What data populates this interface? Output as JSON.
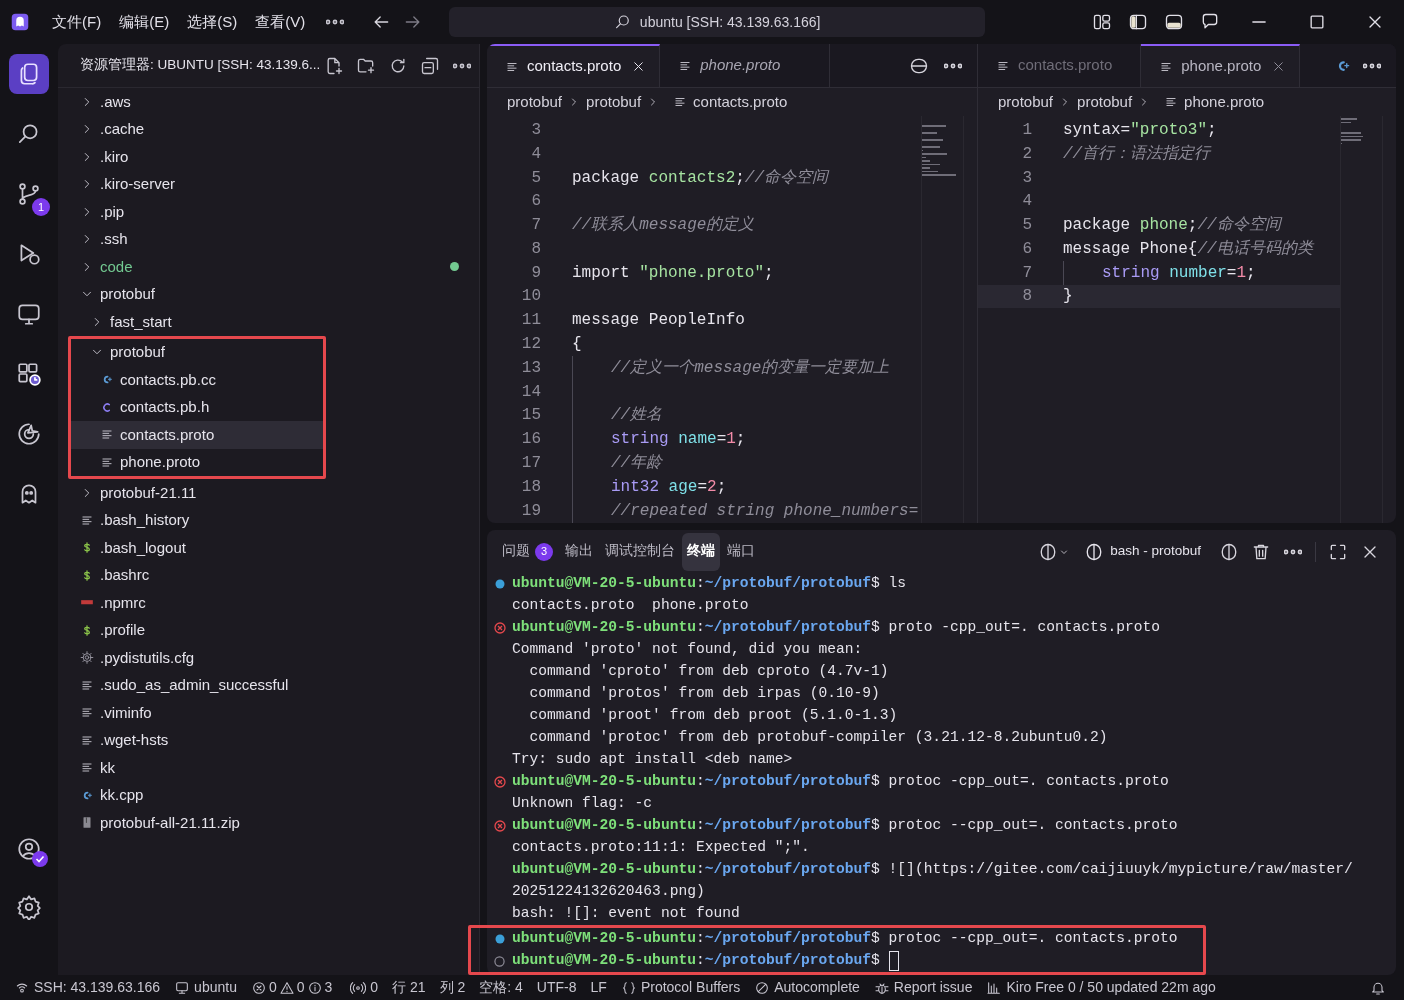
{
  "title_bar": {
    "menus": [
      "文件(F)",
      "编辑(E)",
      "选择(S)",
      "查看(V)"
    ],
    "search": "ubuntu [SSH: 43.139.63.166]"
  },
  "activity_bar": {
    "items": [
      {
        "kind": "explorer",
        "selected": true
      },
      {
        "kind": "search",
        "selected": false
      },
      {
        "kind": "source-control",
        "selected": false,
        "badge": "1"
      },
      {
        "kind": "debug",
        "selected": false
      },
      {
        "kind": "remote",
        "selected": false
      },
      {
        "kind": "extensions",
        "selected": false
      },
      {
        "kind": "kiro",
        "selected": false
      },
      {
        "kind": "chat",
        "selected": false
      }
    ],
    "bottom": [
      {
        "kind": "account"
      },
      {
        "kind": "settings"
      }
    ]
  },
  "explorer": {
    "title": "资源管理器: UBUNTU [SSH: 43.139.6...",
    "tree": [
      {
        "label": ".aws",
        "kind": "folder",
        "expanded": false,
        "selected": false,
        "untracked": false
      },
      {
        "label": ".cache",
        "kind": "folder",
        "expanded": false,
        "selected": false,
        "untracked": false
      },
      {
        "label": ".kiro",
        "kind": "folder",
        "expanded": false,
        "selected": false,
        "untracked": false
      },
      {
        "label": ".kiro-server",
        "kind": "folder",
        "expanded": false,
        "selected": false,
        "untracked": false
      },
      {
        "label": ".pip",
        "kind": "folder",
        "expanded": false,
        "selected": false,
        "untracked": false
      },
      {
        "label": ".ssh",
        "kind": "folder",
        "expanded": false,
        "selected": false,
        "untracked": false
      },
      {
        "label": "code",
        "kind": "folder",
        "expanded": false,
        "selected": false,
        "untracked": true
      },
      {
        "label": "protobuf",
        "kind": "folder",
        "expanded": true,
        "selected": false,
        "untracked": false,
        "children": [
          {
            "label": "fast_start",
            "kind": "folder",
            "expanded": false,
            "selected": false,
            "untracked": false
          },
          {
            "label": "protobuf",
            "kind": "folder",
            "expanded": true,
            "selected": false,
            "untracked": false,
            "highlighted": true,
            "children": [
              {
                "label": "contacts.pb.cc",
                "kind": "cpp",
                "selected": false,
                "untracked": false
              },
              {
                "label": "contacts.pb.h",
                "kind": "c",
                "selected": false,
                "untracked": false
              },
              {
                "label": "contacts.proto",
                "kind": "text",
                "selected": true,
                "untracked": false
              },
              {
                "label": "phone.proto",
                "kind": "text",
                "selected": false,
                "untracked": false
              }
            ]
          }
        ]
      },
      {
        "label": "protobuf-21.11",
        "kind": "folder",
        "expanded": false,
        "selected": false,
        "untracked": false
      },
      {
        "label": ".bash_history",
        "kind": "text",
        "selected": false,
        "untracked": false
      },
      {
        "label": ".bash_logout",
        "kind": "shell",
        "selected": false,
        "untracked": false
      },
      {
        "label": ".bashrc",
        "kind": "shell",
        "selected": false,
        "untracked": false
      },
      {
        "label": ".npmrc",
        "kind": "npm",
        "selected": false,
        "untracked": false
      },
      {
        "label": ".profile",
        "kind": "shell",
        "selected": false,
        "untracked": false
      },
      {
        "label": ".pydistutils.cfg",
        "kind": "config",
        "selected": false,
        "untracked": false
      },
      {
        "label": ".sudo_as_admin_successful",
        "kind": "text",
        "selected": false,
        "untracked": false
      },
      {
        "label": ".viminfo",
        "kind": "text",
        "selected": false,
        "untracked": false
      },
      {
        "label": ".wget-hsts",
        "kind": "text",
        "selected": false,
        "untracked": false
      },
      {
        "label": "kk",
        "kind": "text",
        "selected": false,
        "untracked": false
      },
      {
        "label": "kk.cpp",
        "kind": "cpp",
        "selected": false,
        "untracked": false
      },
      {
        "label": "protobuf-all-21.11.zip",
        "kind": "archive",
        "selected": false,
        "untracked": false
      }
    ]
  },
  "editor_groups": [
    {
      "tabs": [
        {
          "label": "contacts.proto",
          "selected": true,
          "preview": false
        },
        {
          "label": "phone.proto",
          "selected": false,
          "preview": true
        }
      ],
      "breadcrumbs": [
        "protobuf",
        "protobuf",
        "contacts.proto"
      ],
      "lines": [
        {
          "number": "3",
          "current": false,
          "indented": false
        },
        {
          "number": "4",
          "current": false,
          "indented": false
        },
        {
          "number": "5",
          "current": false,
          "indented": false,
          "tokens": [
            {
              "text": "package ",
              "kind": "plain"
            },
            {
              "text": "contacts2",
              "kind": "string"
            },
            {
              "text": ";",
              "kind": "plain"
            },
            {
              "text": "//命令空间",
              "kind": "comment"
            }
          ]
        },
        {
          "number": "6",
          "current": false,
          "indented": false
        },
        {
          "number": "7",
          "current": false,
          "indented": false,
          "tokens": [
            {
              "text": "//联系人message的定义",
              "kind": "comment"
            }
          ]
        },
        {
          "number": "8",
          "current": false,
          "indented": false
        },
        {
          "number": "9",
          "current": false,
          "indented": false,
          "tokens": [
            {
              "text": "import ",
              "kind": "plain"
            },
            {
              "text": "\"phone.proto\"",
              "kind": "string"
            },
            {
              "text": ";",
              "kind": "plain"
            }
          ]
        },
        {
          "number": "10",
          "current": false,
          "indented": false
        },
        {
          "number": "11",
          "current": false,
          "indented": false,
          "tokens": [
            {
              "text": "message PeopleInfo",
              "kind": "plain"
            }
          ]
        },
        {
          "number": "12",
          "current": false,
          "indented": false,
          "tokens": [
            {
              "text": "{",
              "kind": "plain"
            }
          ]
        },
        {
          "number": "13",
          "current": false,
          "indented": true,
          "tokens": [
            {
              "text": "//定义一个message的变量一定要加上",
              "kind": "comment"
            }
          ]
        },
        {
          "number": "14",
          "current": false,
          "indented": true
        },
        {
          "number": "15",
          "current": false,
          "indented": true,
          "tokens": [
            {
              "text": "//姓名",
              "kind": "comment"
            }
          ]
        },
        {
          "number": "16",
          "current": false,
          "indented": true,
          "tokens": [
            {
              "text": "string ",
              "kind": "type"
            },
            {
              "text": "name",
              "kind": "name"
            },
            {
              "text": "=",
              "kind": "plain"
            },
            {
              "text": "1",
              "kind": "number"
            },
            {
              "text": ";",
              "kind": "plain"
            }
          ]
        },
        {
          "number": "17",
          "current": false,
          "indented": true,
          "tokens": [
            {
              "text": "//年龄",
              "kind": "comment"
            }
          ]
        },
        {
          "number": "18",
          "current": false,
          "indented": true,
          "tokens": [
            {
              "text": "int32 ",
              "kind": "type"
            },
            {
              "text": "age",
              "kind": "name"
            },
            {
              "text": "=",
              "kind": "plain"
            },
            {
              "text": "2",
              "kind": "number"
            },
            {
              "text": ";",
              "kind": "plain"
            }
          ]
        },
        {
          "number": "19",
          "current": false,
          "indented": true,
          "tokens": [
            {
              "text": "//repeated string phone_numbers=",
              "kind": "comment"
            }
          ]
        }
      ]
    },
    {
      "tabs": [
        {
          "label": "contacts.proto",
          "selected": false,
          "preview": false
        },
        {
          "label": "phone.proto",
          "selected": true,
          "preview": false
        }
      ],
      "breadcrumbs": [
        "protobuf",
        "protobuf",
        "phone.proto"
      ],
      "lines": [
        {
          "number": "1",
          "current": false,
          "indented": false,
          "tokens": [
            {
              "text": "syntax=",
              "kind": "plain"
            },
            {
              "text": "\"proto3\"",
              "kind": "string"
            },
            {
              "text": ";",
              "kind": "plain"
            }
          ]
        },
        {
          "number": "2",
          "current": false,
          "indented": false,
          "tokens": [
            {
              "text": "//首行：语法指定行",
              "kind": "comment"
            }
          ]
        },
        {
          "number": "3",
          "current": false,
          "indented": false
        },
        {
          "number": "4",
          "current": false,
          "indented": false
        },
        {
          "number": "5",
          "current": false,
          "indented": false,
          "tokens": [
            {
              "text": "package ",
              "kind": "plain"
            },
            {
              "text": "phone",
              "kind": "string"
            },
            {
              "text": ";",
              "kind": "plain"
            },
            {
              "text": "//命令空间",
              "kind": "comment"
            }
          ]
        },
        {
          "number": "6",
          "current": false,
          "indented": false,
          "tokens": [
            {
              "text": "message Phone{",
              "kind": "plain"
            },
            {
              "text": "//电话号码的类",
              "kind": "comment"
            }
          ]
        },
        {
          "number": "7",
          "current": false,
          "indented": true,
          "tokens": [
            {
              "text": "string ",
              "kind": "type"
            },
            {
              "text": "number",
              "kind": "name"
            },
            {
              "text": "=",
              "kind": "plain"
            },
            {
              "text": "1",
              "kind": "number"
            },
            {
              "text": ";",
              "kind": "plain"
            }
          ]
        },
        {
          "number": "8",
          "current": true,
          "indented": false,
          "tokens": [
            {
              "text": "}",
              "kind": "plain"
            }
          ]
        }
      ]
    }
  ],
  "panel": {
    "tabs": [
      {
        "label": "问题",
        "badge": "3",
        "selected": false
      },
      {
        "label": "输出",
        "selected": false
      },
      {
        "label": "调试控制台",
        "selected": false
      },
      {
        "label": "终端",
        "selected": true
      },
      {
        "label": "端口",
        "selected": false
      }
    ],
    "terminal_name": "bash - protobuf",
    "terminal": {
      "lines": [
        {
          "kind": "prompt",
          "marker": {
            "kind": "success"
          },
          "highlighted": false,
          "user": "ubuntu@VM-20-5-ubuntu",
          "sep": ":",
          "path": "~/protobuf/protobuf",
          "symbol": "$",
          "command": "ls"
        },
        {
          "kind": "output",
          "highlighted": false,
          "text": "contacts.proto  phone.proto"
        },
        {
          "kind": "prompt",
          "marker": {
            "kind": "error"
          },
          "highlighted": false,
          "user": "ubuntu@VM-20-5-ubuntu",
          "sep": ":",
          "path": "~/protobuf/protobuf",
          "symbol": "$",
          "command": "proto -cpp_out=. contacts.proto"
        },
        {
          "kind": "output",
          "highlighted": false,
          "text": "Command 'proto' not found, did you mean:"
        },
        {
          "kind": "output",
          "highlighted": false,
          "text": "  command 'cproto' from deb cproto (4.7v-1)"
        },
        {
          "kind": "output",
          "highlighted": false,
          "text": "  command 'protos' from deb irpas (0.10-9)"
        },
        {
          "kind": "output",
          "highlighted": false,
          "text": "  command 'proot' from deb proot (5.1.0-1.3)"
        },
        {
          "kind": "output",
          "highlighted": false,
          "text": "  command 'protoc' from deb protobuf-compiler (3.21.12-8.2ubuntu0.2)"
        },
        {
          "kind": "output",
          "highlighted": false,
          "text": "Try: sudo apt install <deb name>"
        },
        {
          "kind": "prompt",
          "marker": {
            "kind": "error"
          },
          "highlighted": false,
          "user": "ubuntu@VM-20-5-ubuntu",
          "sep": ":",
          "path": "~/protobuf/protobuf",
          "symbol": "$",
          "command": "protoc -cpp_out=. contacts.proto"
        },
        {
          "kind": "output",
          "highlighted": false,
          "text": "Unknown flag: -c"
        },
        {
          "kind": "prompt",
          "marker": {
            "kind": "error"
          },
          "highlighted": false,
          "user": "ubuntu@VM-20-5-ubuntu",
          "sep": ":",
          "path": "~/protobuf/protobuf",
          "symbol": "$",
          "command": "protoc --cpp_out=. contacts.proto"
        },
        {
          "kind": "output",
          "highlighted": false,
          "text": "contacts.proto:11:1: Expected \";\"."
        },
        {
          "kind": "prompt",
          "highlighted": false,
          "user": "ubuntu@VM-20-5-ubuntu",
          "sep": ":",
          "path": "~/protobuf/protobuf",
          "symbol": "$",
          "command": "![](https://gitee.com/caijiuuyk/mypicture/raw/master/"
        },
        {
          "kind": "output",
          "highlighted": false,
          "text": "20251224132620463.png)"
        },
        {
          "kind": "output",
          "highlighted": false,
          "text": "bash: ![]: event not found"
        },
        {
          "kind": "prompt",
          "marker": {
            "kind": "success"
          },
          "highlighted": true,
          "user": "ubuntu@VM-20-5-ubuntu",
          "sep": ":",
          "path": "~/protobuf/protobuf",
          "symbol": "$",
          "command": "protoc --cpp_out=. contacts.proto"
        },
        {
          "kind": "prompt",
          "marker": {
            "kind": "pending"
          },
          "highlighted": true,
          "cursor": true,
          "user": "ubuntu@VM-20-5-ubuntu",
          "sep": ":",
          "path": "~/protobuf/protobuf",
          "symbol": "$"
        }
      ]
    }
  },
  "status_bar": [
    {
      "kind": "remote",
      "text": "SSH: 43.139.63.166"
    },
    {
      "kind": "host",
      "text": "ubuntu"
    },
    {
      "kind": "problems",
      "errors": "0",
      "warnings": "0",
      "infos": "3"
    },
    {
      "kind": "ports",
      "text": "0"
    },
    {
      "kind": "plain",
      "text": "行 21"
    },
    {
      "kind": "plain",
      "text": "列 2"
    },
    {
      "kind": "plain",
      "text": "空格: 4"
    },
    {
      "kind": "plain",
      "text": "UTF-8"
    },
    {
      "kind": "plain",
      "text": "LF"
    },
    {
      "kind": "language",
      "text": "Protocol Buffers"
    },
    {
      "kind": "autocomplete",
      "text": "Autocomplete"
    },
    {
      "kind": "bug",
      "text": "Report issue"
    },
    {
      "kind": "kiro",
      "text": "Kiro Free 0 / 50 updated 22m ago"
    },
    {
      "kind": "bell"
    }
  ]
}
